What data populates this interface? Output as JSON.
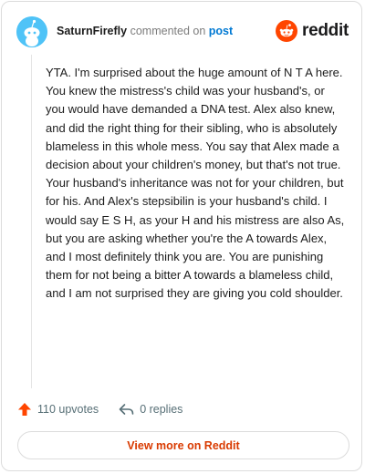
{
  "header": {
    "username": "SaturnFirefly",
    "action_text": "commented on",
    "target_link": "post",
    "brand_name": "reddit"
  },
  "comment": {
    "body": "YTA. I'm surprised about the huge amount of N T A here. You knew the mistress's child was your husband's, or you would have demanded a DNA test. Alex also knew, and did the right thing for their sibling, who is absolutely blameless in this whole mess. You say that Alex made a decision about your children's money, but that's not true. Your husband's inheritance was not for your children, but for his. And Alex's stepsibilin is your husband's child. I would say E S H, as your H and his mistress are also As, but you are asking whether you're the A towards Alex, and I most definitely think you are. You are punishing them for not being a bitter A towards a blameless child, and I am not surprised they are giving you cold shoulder."
  },
  "actions": {
    "upvotes_label": "110 upvotes",
    "replies_label": "0 replies"
  },
  "footer": {
    "view_more_label": "View more on Reddit"
  },
  "colors": {
    "accent": "#ff4500",
    "link": "#0079d3",
    "view_more": "#d93a00",
    "avatar_bg": "#4fc3f7"
  },
  "icons": {
    "avatar": "snoo-avatar-icon",
    "brand": "reddit-logo-icon",
    "upvote": "upvote-arrow-icon",
    "reply": "reply-arrow-icon"
  }
}
